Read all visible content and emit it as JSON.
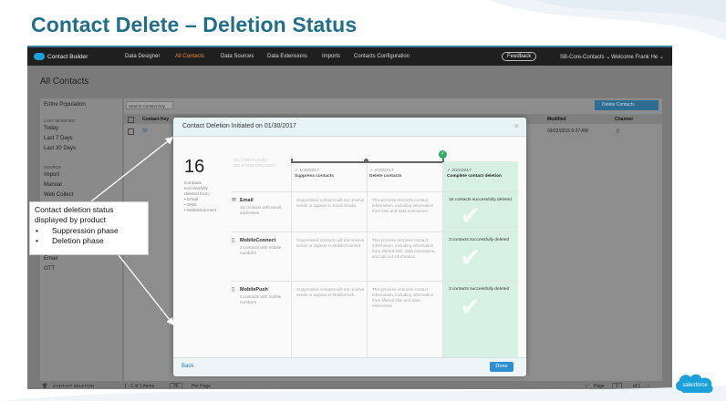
{
  "slide_title": "Contact Delete – Deletion Status",
  "nav": {
    "brand": "Contact Builder",
    "items": [
      "Data Designer",
      "All Contacts",
      "Data Sources",
      "Data Extensions",
      "Imports",
      "Contacts Configuration"
    ],
    "active_index": 1,
    "feedback": "Feedback",
    "account": "SB-Core-Contacts ⌄",
    "welcome": "Welcome  Frank He ⌄"
  },
  "page_title": "All Contacts",
  "left_panel": {
    "entire_population": "Entire Population",
    "last_modified_label": "LAST MODIFIED",
    "last_modified": [
      "Today",
      "Last 7 Days",
      "Last 30 Days"
    ],
    "source_label": "SOURCE",
    "sources": [
      "Import",
      "Manual",
      "Web Collect"
    ],
    "extra": [
      "Email",
      "OTT"
    ],
    "contact_deletion": "CONTACT DELETION"
  },
  "table": {
    "search_placeholder": "Search Contact Key",
    "delete_button": "Delete Contacts",
    "headers": [
      "Contact Key",
      "Modified",
      "Channel"
    ],
    "row": {
      "key": "30",
      "modified": "09/22/2015 6:27 AM"
    }
  },
  "bottom_bar": {
    "items_text": "1 - 1 of 1 items",
    "per_page_value": "25",
    "per_page_label": "Per Page",
    "page_label": "Page",
    "page_value": "1",
    "page_of": "of 1"
  },
  "modal": {
    "title": "Contact Deletion Initiated on 01/30/2017",
    "close": "×",
    "total": "16",
    "summary_lines": [
      "Contacts",
      "successfully",
      "deleted from:",
      "• Email",
      "• SMS",
      "• MobileConnect"
    ],
    "account_level": "ACCOUNT-LEVEL DELETION PROCESS",
    "phases": [
      {
        "date": "1/30/2017",
        "name": "Suppress contacts"
      },
      {
        "date": "2/20/2017",
        "name": "Delete contacts"
      },
      {
        "date": "2/21/2017",
        "name": "Complete contact deletion"
      }
    ],
    "products": [
      {
        "name": "Email",
        "icon": "envelope-icon",
        "desc": "15 contacts with email addresses",
        "suppress": "Suppressed contacts will not receive sends or appear in Email Studio.",
        "delete": "This process removes contact information, including information from lists and data extensions.",
        "complete": "15 contacts successfully deleted"
      },
      {
        "name": "MobileConnect",
        "icon": "mobile-icon",
        "desc": "3 contacts with mobile numbers",
        "suppress": "Suppressed contacts will not receive sends or appear in MobileConnect.",
        "delete": "This process removes contact information, including information from filtered lists, data extensions, and opt-out information.",
        "complete": "3 contacts successfully deleted"
      },
      {
        "name": "MobilePush",
        "icon": "mobile-icon",
        "desc": "3 contacts with mobile numbers",
        "suppress": "Suppressed contacts will not receive sends or appear in MobilePush.",
        "delete": "This process removes contact information, including information from filtered lists and data extensions.",
        "complete": "3 contacts successfully deleted"
      }
    ],
    "back": "Back",
    "done": "Done"
  },
  "callout": {
    "line1": "Contact deletion status displayed by product",
    "bullet_char": "•",
    "bullets": [
      "Suppression phase",
      "Deletion phase"
    ]
  },
  "logo_text": "salesforce",
  "colors": {
    "title": "#1f6f8b",
    "complete_column": "#d6f1e4",
    "check": "#2eaa6c",
    "done_button": "#2f8fd3",
    "nav_active": "#f28b30"
  }
}
